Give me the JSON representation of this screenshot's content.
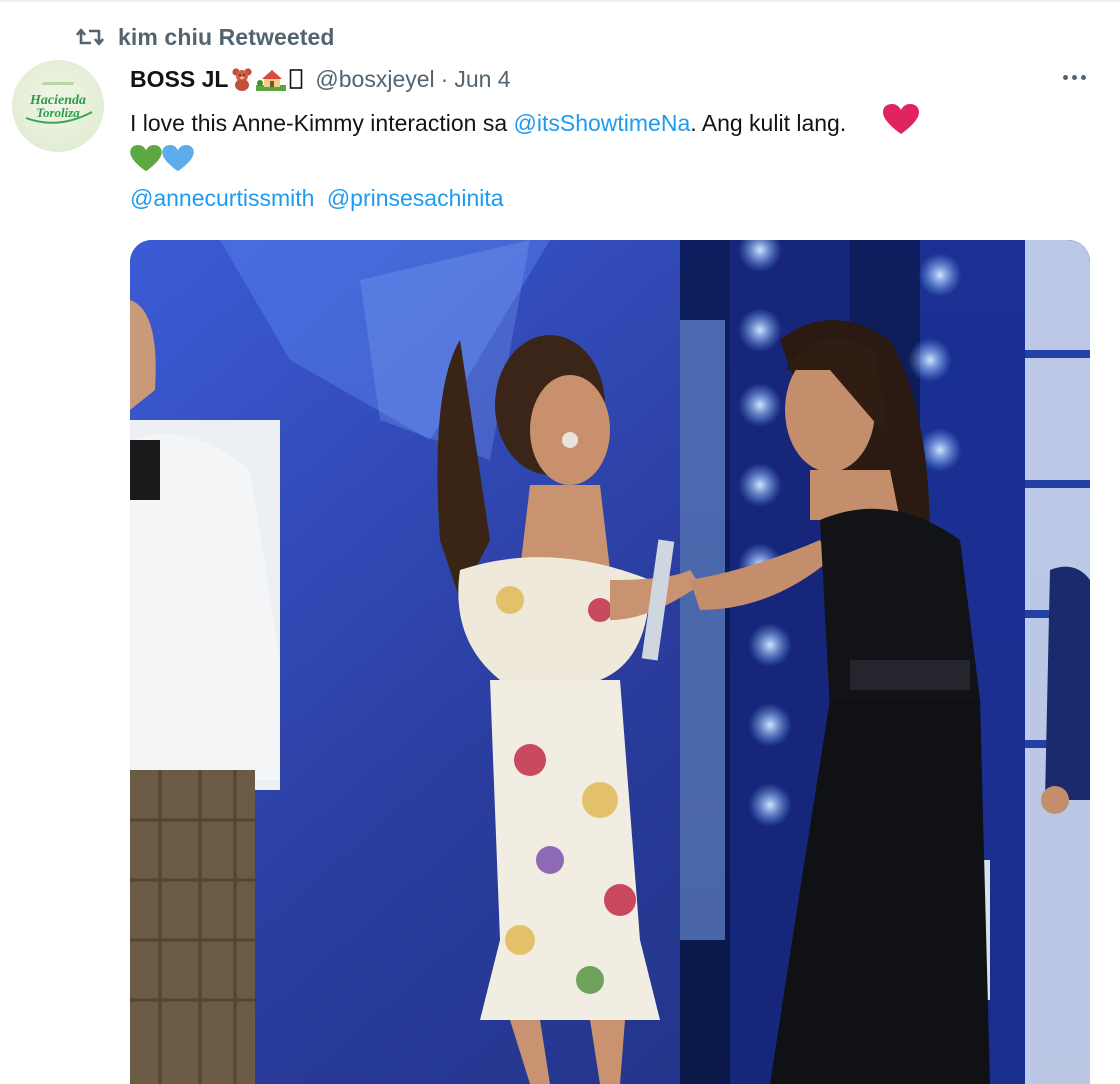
{
  "retweet": {
    "icon": "retweet-icon",
    "label": "kim chiu Retweeted"
  },
  "tweet": {
    "avatar": {
      "icon": "hacienda-toroliza-logo",
      "text_line1": "Hacienda",
      "text_line2": "Toroliza"
    },
    "author": {
      "display_name": "BOSS JL",
      "name_emojis": [
        "teddy-bear-emoji",
        "house-with-garden-emoji",
        "missing-glyph"
      ],
      "handle": "@bosxjeyel",
      "separator": "·",
      "date": "Jun 4"
    },
    "more_icon": "more-options-icon",
    "text_before_link": "I love this Anne-Kimmy interaction sa ",
    "link_mention": "@itsShowtimeNa",
    "text_after_link": ". Ang kulit lang.",
    "emojis": [
      "red-heart-emoji",
      "green-heart-emoji",
      "blue-heart-emoji"
    ],
    "mentions": [
      "@annecurtissmith",
      "@prinsesachinita"
    ],
    "media": {
      "type": "video-still",
      "subject": "stage-scene-two-women-greeting"
    }
  },
  "colors": {
    "text_primary": "#0f1419",
    "text_secondary": "#536471",
    "link": "#1d9bf0",
    "heart_red": "#e0245e",
    "heart_green": "#5da840",
    "heart_blue": "#5dadec",
    "stage_blue": "#2b3f9a"
  }
}
